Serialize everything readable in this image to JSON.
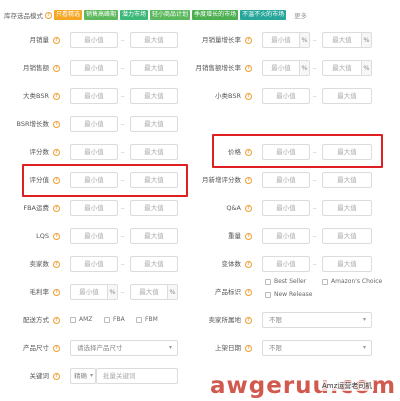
{
  "topbar": {
    "label": "库存选品模式",
    "tags": [
      {
        "text": "只看精选",
        "color": "#f5a623"
      },
      {
        "text": "销售高峰期",
        "color": "#5cb85c"
      },
      {
        "text": "潜力市场",
        "color": "#3cb878"
      },
      {
        "text": "轻小商品计划",
        "color": "#5cb85c"
      },
      {
        "text": "季度增长的市场",
        "color": "#4caf50"
      },
      {
        "text": "不温不火的市场",
        "color": "#26a69a"
      }
    ],
    "more": "更多"
  },
  "ph": {
    "min": "最小值",
    "max": "最大值",
    "pct": "%",
    "dollar": "$"
  },
  "fields": {
    "monthly_sales": "月销量",
    "monthly_sales_growth": "月销量增长率",
    "monthly_revenue": "月销售额",
    "monthly_revenue_growth": "月销售额增长率",
    "bsr_large": "大类BSR",
    "bsr_small": "小类BSR",
    "bsr_growth": "BSR增长数",
    "price": "价格",
    "review_count": "评分数",
    "rating": "评分值",
    "monthly_new_reviews": "月新增评分数",
    "fba_fee": "FBA运费",
    "qa": "Q&A",
    "lqs": "LQS",
    "weight": "重量",
    "variants": "变体数",
    "sellers": "卖家数",
    "gross_margin": "毛利率",
    "product_badge": "产品标识",
    "fulfillment": "配送方式",
    "seller_location": "卖家所属地",
    "product_size": "产品尺寸",
    "launch_date": "上架日期",
    "keyword": "关键词"
  },
  "badges": [
    "Best Seller",
    "Amazon's Choice",
    "New Release"
  ],
  "fulfillment_opts": [
    "AMZ",
    "FBA",
    "FBM"
  ],
  "selects": {
    "seller_location": "不限",
    "product_size": "请选择产品尺寸",
    "launch_date": "不限"
  },
  "keyword": {
    "mode": "精确",
    "placeholder": "批量关键词"
  },
  "watermark": "awgeruu.com",
  "watermark2": "Amz运营老司机"
}
